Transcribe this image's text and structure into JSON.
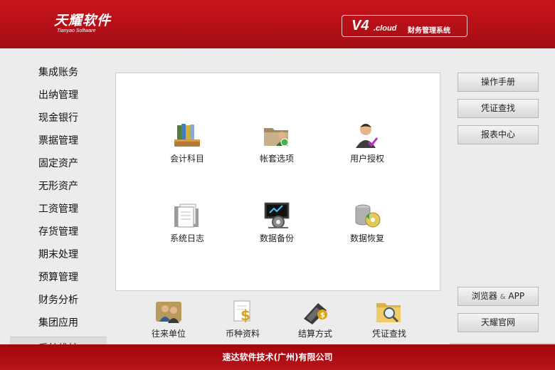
{
  "header": {
    "logo_cn": "天耀软件",
    "logo_en": "Tianyao Software",
    "version": "V4",
    "version_suffix": ".cloud",
    "system_name": "财务管理系统"
  },
  "sidebar": {
    "items": [
      {
        "label": "集成账务"
      },
      {
        "label": "出纳管理"
      },
      {
        "label": "现金银行"
      },
      {
        "label": "票据管理"
      },
      {
        "label": "固定资产"
      },
      {
        "label": "无形资产"
      },
      {
        "label": "工资管理"
      },
      {
        "label": "存货管理"
      },
      {
        "label": "期末处理"
      },
      {
        "label": "预算管理"
      },
      {
        "label": "财务分析"
      },
      {
        "label": "集团应用"
      },
      {
        "label": "系统维护"
      }
    ]
  },
  "main": {
    "icons": [
      {
        "label": "会计科目",
        "icon": "binders-icon"
      },
      {
        "label": "帐套选项",
        "icon": "folder-user-icon"
      },
      {
        "label": "用户授权",
        "icon": "user-check-icon"
      },
      {
        "label": "系统日志",
        "icon": "log-files-icon"
      },
      {
        "label": "数据备份",
        "icon": "backup-gear-icon"
      },
      {
        "label": "数据恢复",
        "icon": "restore-disk-icon"
      }
    ]
  },
  "bottom_icons": [
    {
      "label": "往来单位",
      "icon": "contacts-icon"
    },
    {
      "label": "币种资料",
      "icon": "currency-icon"
    },
    {
      "label": "结算方式",
      "icon": "pos-terminal-icon"
    },
    {
      "label": "凭证查找",
      "icon": "folder-search-icon"
    }
  ],
  "right_buttons": {
    "manual": "操作手册",
    "voucher_search": "凭证查找",
    "report_center": "报表中心",
    "browser_app_1": "浏览器",
    "browser_app_amp": "&",
    "browser_app_2": "APP",
    "official_site": "天耀官网"
  },
  "footer": {
    "text": "速达软件技术(广州)有限公司"
  },
  "colors": {
    "brand_red": "#b4111a",
    "background": "#ececec",
    "panel": "#ffffff"
  }
}
